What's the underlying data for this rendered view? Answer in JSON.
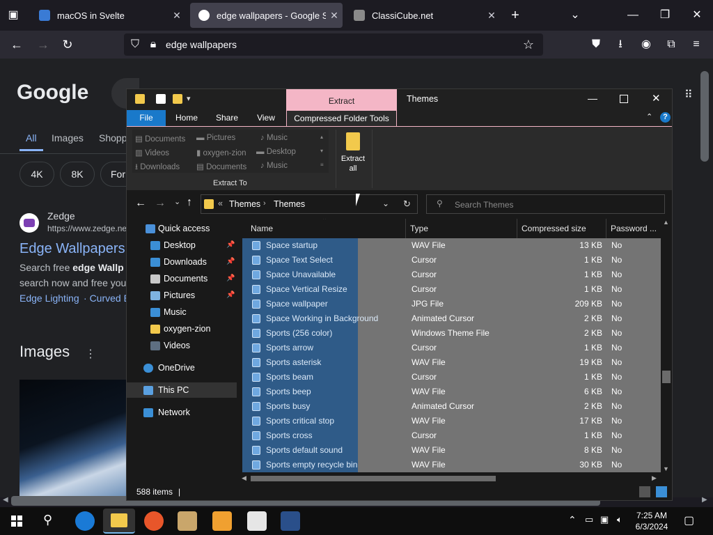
{
  "browser": {
    "tabs": [
      {
        "title": "macOS in Svelte",
        "close": "✕"
      },
      {
        "title": "edge wallpapers - Google Search",
        "close": "✕"
      },
      {
        "title": "ClassiCube.net",
        "close": "✕"
      }
    ],
    "new_tab": "+",
    "url": "edge wallpapers"
  },
  "google": {
    "logo": "Google",
    "tabs": [
      "All",
      "Images",
      "Shopping"
    ],
    "chips": [
      "4K",
      "8K",
      "For"
    ],
    "result": {
      "site_name": "Zedge",
      "site_url": "https://www.zedge.net",
      "title": "Edge Wallpapers",
      "snippet_1_prefix": "Search free ",
      "snippet_1_bold": "edge Wallp",
      "snippet_2": "search now and free you",
      "links": [
        "Edge Lighting",
        "Curved E"
      ]
    },
    "images_heading": "Images"
  },
  "explorer": {
    "title": "Themes",
    "extract_context_tab": "Extract",
    "ribbon_tabs": [
      "File",
      "Home",
      "Share",
      "View",
      "Compressed Folder Tools"
    ],
    "extract_to_items": [
      [
        "Documents",
        "Pictures",
        "Music"
      ],
      [
        "Videos",
        "oxygen-zion",
        "Desktop"
      ],
      [
        "Downloads",
        "Documents",
        "Music"
      ]
    ],
    "extract_to_label": "Extract To",
    "extract_all_label_1": "Extract",
    "extract_all_label_2": "all",
    "breadcrumb": [
      "Themes",
      "Themes"
    ],
    "breadcrumb_prefix": "«",
    "search_placeholder": "Search Themes",
    "nav": [
      {
        "label": "Quick access",
        "pin": ""
      },
      {
        "label": "Desktop",
        "pin": "📌"
      },
      {
        "label": "Downloads",
        "pin": "📌"
      },
      {
        "label": "Documents",
        "pin": "📌"
      },
      {
        "label": "Pictures",
        "pin": "📌"
      },
      {
        "label": "Music",
        "pin": ""
      },
      {
        "label": "oxygen-zion",
        "pin": ""
      },
      {
        "label": "Videos",
        "pin": ""
      },
      {
        "label": "OneDrive",
        "pin": ""
      },
      {
        "label": "This PC",
        "pin": ""
      },
      {
        "label": "Network",
        "pin": ""
      }
    ],
    "columns": [
      "Name",
      "Type",
      "Compressed size",
      "Password ..."
    ],
    "files": [
      {
        "name": "Space startup",
        "type": "WAV File",
        "size": "13 KB",
        "pw": "No"
      },
      {
        "name": "Space Text Select",
        "type": "Cursor",
        "size": "1 KB",
        "pw": "No"
      },
      {
        "name": "Space Unavailable",
        "type": "Cursor",
        "size": "1 KB",
        "pw": "No"
      },
      {
        "name": "Space Vertical Resize",
        "type": "Cursor",
        "size": "1 KB",
        "pw": "No"
      },
      {
        "name": "Space wallpaper",
        "type": "JPG File",
        "size": "209 KB",
        "pw": "No"
      },
      {
        "name": "Space Working in Background",
        "type": "Animated Cursor",
        "size": "2 KB",
        "pw": "No"
      },
      {
        "name": "Sports (256 color)",
        "type": "Windows Theme File",
        "size": "2 KB",
        "pw": "No"
      },
      {
        "name": "Sports arrow",
        "type": "Cursor",
        "size": "1 KB",
        "pw": "No"
      },
      {
        "name": "Sports asterisk",
        "type": "WAV File",
        "size": "19 KB",
        "pw": "No"
      },
      {
        "name": "Sports beam",
        "type": "Cursor",
        "size": "1 KB",
        "pw": "No"
      },
      {
        "name": "Sports beep",
        "type": "WAV File",
        "size": "6 KB",
        "pw": "No"
      },
      {
        "name": "Sports busy",
        "type": "Animated Cursor",
        "size": "2 KB",
        "pw": "No"
      },
      {
        "name": "Sports critical stop",
        "type": "WAV File",
        "size": "17 KB",
        "pw": "No"
      },
      {
        "name": "Sports cross",
        "type": "Cursor",
        "size": "1 KB",
        "pw": "No"
      },
      {
        "name": "Sports default sound",
        "type": "WAV File",
        "size": "8 KB",
        "pw": "No"
      },
      {
        "name": "Sports empty recycle bin",
        "type": "WAV File",
        "size": "30 KB",
        "pw": "No"
      }
    ],
    "item_count": "588 items"
  },
  "taskbar": {
    "time": "7:25 AM",
    "date": "6/3/2024"
  }
}
